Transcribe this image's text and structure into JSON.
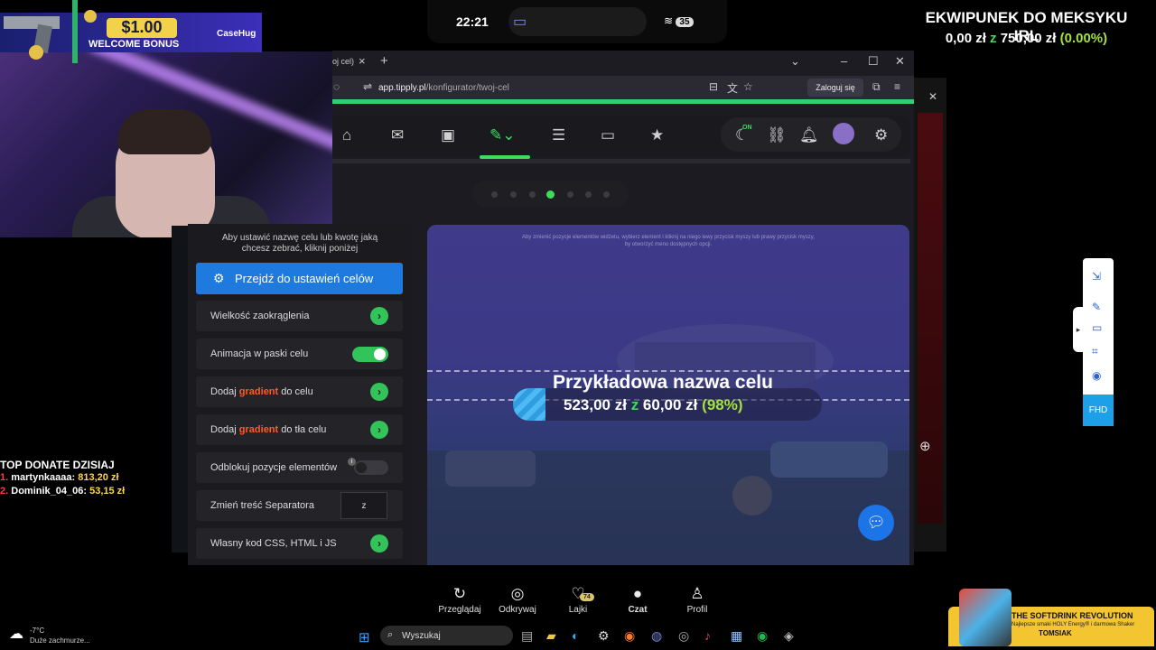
{
  "phone_status": {
    "time": "22:21",
    "battery": "35"
  },
  "overlay": {
    "goal_title": "EKWIPUNEK DO MEKSYKU IRL",
    "goal_current": "0,00 zł",
    "goal_sep": "z",
    "goal_target": "750,00 zł",
    "goal_percent": "(0.00%)"
  },
  "bonus_banner": {
    "amount": "$1.00",
    "text": "WELCOME BONUS",
    "brand": "CaseHug"
  },
  "browser": {
    "tab_title": "oj cel)",
    "tab_close": "×",
    "new_tab": "+",
    "url_domain": "app.tipply.pl",
    "url_path": "/konfigurator/twoj-cel",
    "login_label": "Zaloguj się",
    "win_min": "–",
    "win_max": "☐",
    "win_close": "✕",
    "dropdown": "⌄"
  },
  "app_nav": {
    "items": [
      "home-icon",
      "mail-icon",
      "wallet-icon",
      "edit-icon",
      "layers-icon",
      "window-icon",
      "star-icon"
    ],
    "on_label": "ON"
  },
  "panel": {
    "note": "Aby ustawić nazwę celu lub kwotę jaką chcesz zebrać, kliknij poniżej",
    "goto_label": "Przejdź do ustawień celów",
    "rows": {
      "rounding": "Wielkość zaokrąglenia",
      "animation": "Animacja w paski celu",
      "gradient1_pre": "Dodaj ",
      "gradient1_accent": "gradient",
      "gradient1_post": " do celu",
      "gradient2_pre": "Dodaj ",
      "gradient2_accent": "gradient",
      "gradient2_post": " do tła celu",
      "unlock": "Odblokuj pozycje elementów",
      "separator": "Zmień treść Separatora",
      "separator_value": "z",
      "custom_code": "Własny kod CSS, HTML i JS"
    },
    "go_glyph": "›",
    "info_glyph": "i"
  },
  "preview": {
    "note": "Aby zmienić pozycje elementów widżetu, wybierz element i kliknij na niego lewy przycisk myszy lub prawy przycisk myszy, by otworzyć menu dostępnych opcji.",
    "goal_name": "Przykładowa nazwa celu",
    "current": "523,00 zł",
    "sep": "z",
    "target": "60,00 zł",
    "percent": "(98%)"
  },
  "side_tools": {
    "fhd": "FHD"
  },
  "donate": {
    "title": "TOP DONATE DZISIAJ",
    "entries": [
      {
        "rank": "1.",
        "name": "martynkaaaa:",
        "amount": "813,20 zł"
      },
      {
        "rank": "2.",
        "name": "Dominik_04_06:",
        "amount": "53,15 zł"
      }
    ]
  },
  "bottom_nav": {
    "items": [
      {
        "label": "Przeglądaj",
        "icon": "refresh-icon"
      },
      {
        "label": "Odkrywaj",
        "icon": "compass-icon"
      },
      {
        "label": "Lajki",
        "icon": "heart-icon"
      },
      {
        "label": "Czat",
        "icon": "chat-icon"
      },
      {
        "label": "Profil",
        "icon": "profile-icon"
      }
    ],
    "likes_badge": "74"
  },
  "taskbar": {
    "weather_temp": "-7°C",
    "weather_desc": "Duże zachmurze...",
    "search_placeholder": "Wyszukaj"
  },
  "sponsor": {
    "title": "THE SOFTDRINK REVOLUTION",
    "subtitle": "Najlepsze smaki HOLY Energy® i darmowa Shaker",
    "name": "TOMSIAK"
  }
}
